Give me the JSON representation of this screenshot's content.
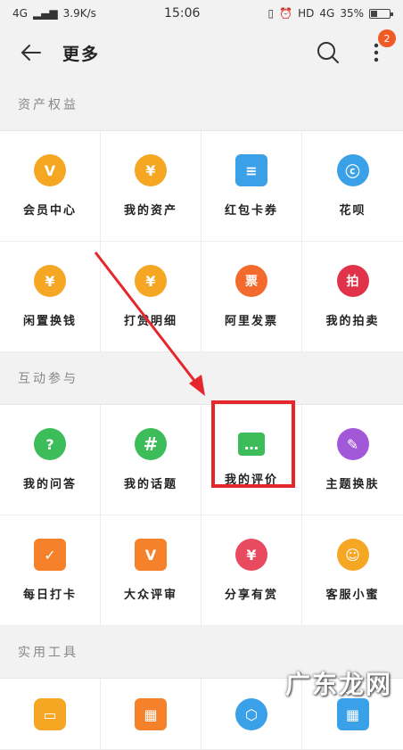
{
  "status": {
    "network": "4G",
    "speed": "3.9K/s",
    "time": "15:06",
    "hd": "HD",
    "network_right": "4G",
    "battery": "35%"
  },
  "header": {
    "title": "更多",
    "badge": "2"
  },
  "sections": [
    {
      "label": "资产权益",
      "items": [
        {
          "label": "会员中心",
          "glyph": "V",
          "color": "#f5a623"
        },
        {
          "label": "我的资产",
          "glyph": "¥",
          "color": "#f5a623"
        },
        {
          "label": "红包卡券",
          "glyph": "≡",
          "color": "#3aa0e8"
        },
        {
          "label": "花呗",
          "glyph": "ⓒ",
          "color": "#3aa0e8"
        },
        {
          "label": "闲置换钱",
          "glyph": "¥",
          "color": "#f5a623"
        },
        {
          "label": "打赏明细",
          "glyph": "¥",
          "color": "#f5a623"
        },
        {
          "label": "阿里发票",
          "glyph": "票",
          "color": "#f26b2d"
        },
        {
          "label": "我的拍卖",
          "glyph": "拍",
          "color": "#e0334a"
        }
      ]
    },
    {
      "label": "互动参与",
      "items": [
        {
          "label": "我的问答",
          "glyph": "?",
          "color": "#3dbd5a"
        },
        {
          "label": "我的话题",
          "glyph": "#",
          "color": "#3dbd5a"
        },
        {
          "label": "我的评价",
          "glyph": "…",
          "color": "#3dbd5a"
        },
        {
          "label": "主题换肤",
          "glyph": "✎",
          "color": "#a259d9"
        },
        {
          "label": "每日打卡",
          "glyph": "✓",
          "color": "#f5822b"
        },
        {
          "label": "大众评审",
          "glyph": "V",
          "color": "#f5822b"
        },
        {
          "label": "分享有赏",
          "glyph": "¥",
          "color": "#e84a5f"
        },
        {
          "label": "客服小蜜",
          "glyph": "☺",
          "color": "#f5a623"
        }
      ]
    },
    {
      "label": "实用工具",
      "items": [
        {
          "label": "",
          "glyph": "▭",
          "color": "#f5a623"
        },
        {
          "label": "",
          "glyph": "▦",
          "color": "#f5822b"
        },
        {
          "label": "",
          "glyph": "⬡",
          "color": "#3aa0e8"
        },
        {
          "label": "",
          "glyph": "▦",
          "color": "#3aa0e8"
        }
      ]
    }
  ],
  "watermark": "广东龙网"
}
